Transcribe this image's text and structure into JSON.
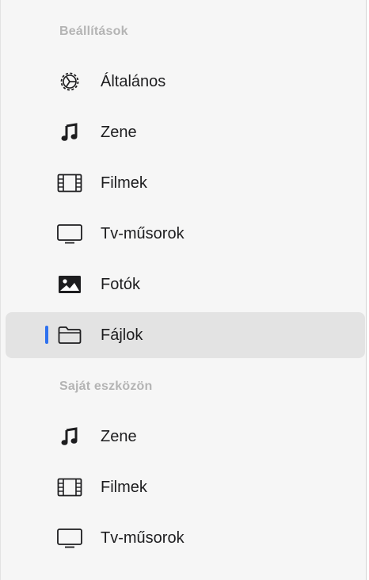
{
  "sections": [
    {
      "header": "Beállítások",
      "items": [
        {
          "label": "Általános",
          "icon": "gear-icon"
        },
        {
          "label": "Zene",
          "icon": "music-note-icon"
        },
        {
          "label": "Filmek",
          "icon": "film-icon"
        },
        {
          "label": "Tv-műsorok",
          "icon": "tv-icon"
        },
        {
          "label": "Fotók",
          "icon": "photo-icon"
        },
        {
          "label": "Fájlok",
          "icon": "folder-icon",
          "selected": true
        }
      ]
    },
    {
      "header": "Saját eszközön",
      "items": [
        {
          "label": "Zene",
          "icon": "music-note-icon"
        },
        {
          "label": "Filmek",
          "icon": "film-icon"
        },
        {
          "label": "Tv-műsorok",
          "icon": "tv-icon"
        }
      ]
    }
  ],
  "colors": {
    "accent": "#2f72ee",
    "selected_background": "#e3e3e3",
    "header_text": "#b4b4b4",
    "item_text": "#1d1d1f"
  }
}
